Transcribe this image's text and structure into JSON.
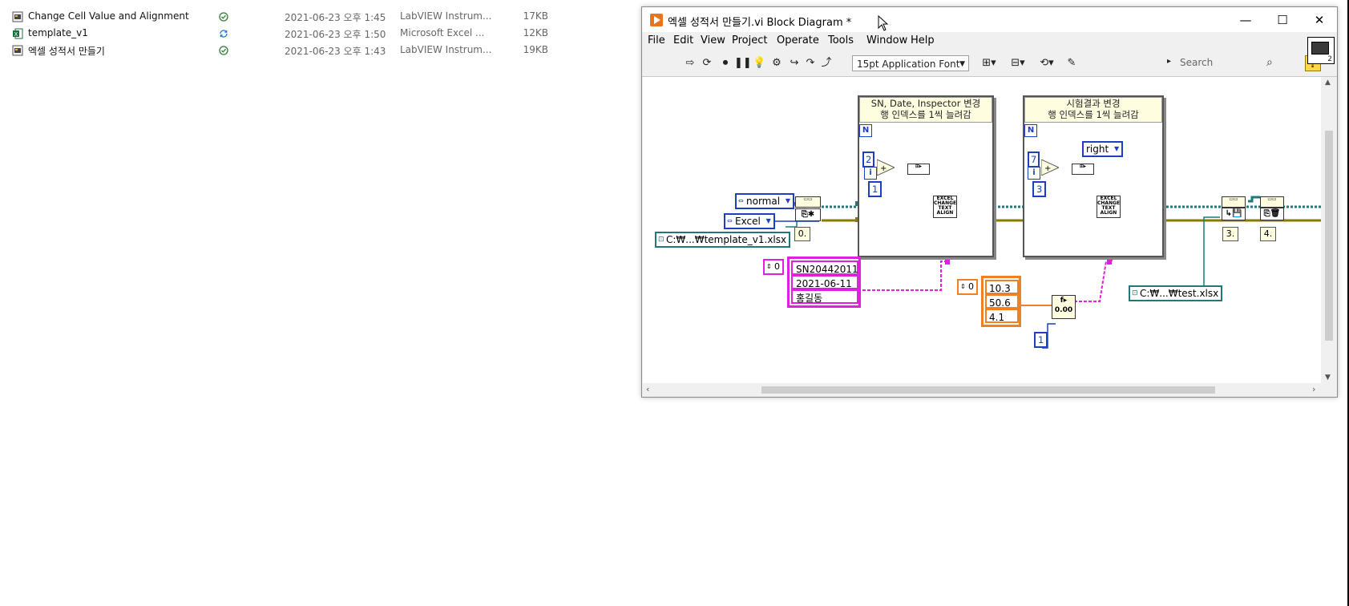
{
  "explorer": {
    "files": [
      {
        "name": "Change Cell Value and Alignment",
        "icon": "labview-vi-icon",
        "status": "synced-check-icon",
        "date": "2021-06-23 오후 1:45",
        "type": "LabVIEW Instrum...",
        "size": "17KB"
      },
      {
        "name": "template_v1",
        "icon": "excel-file-icon",
        "status": "sync-pending-icon",
        "date": "2021-06-23 오후 1:50",
        "type": "Microsoft Excel ...",
        "size": "12KB"
      },
      {
        "name": "엑셀 성적서 만들기",
        "icon": "labview-vi-icon",
        "status": "synced-check-icon",
        "date": "2021-06-23 오후 1:43",
        "type": "LabVIEW Instrum...",
        "size": "19KB"
      }
    ]
  },
  "window": {
    "title": "엑셀 성적서 만들기.vi Block Diagram *",
    "controls": {
      "minimize": "—",
      "maximize": "☐",
      "close": "✕"
    }
  },
  "menu": [
    "File",
    "Edit",
    "View",
    "Project",
    "Operate",
    "Tools",
    "Window",
    "Help"
  ],
  "toolbar": {
    "font": "15pt Application Font",
    "search_placeholder": "Search",
    "help": "?",
    "vi_icon_number": "2"
  },
  "diagram": {
    "loop1": {
      "label_line1": "SN, Date, Inspector 변경",
      "label_line2": "행 인덱스를 1씩 늘려감",
      "count_terminal": "N",
      "iteration_terminal": "i",
      "start_row": "2",
      "step": "1"
    },
    "loop2": {
      "label_line1": "시험결과 변경",
      "label_line2": "행 인덱스를 1씩 늘려감",
      "count_terminal": "N",
      "iteration_terminal": "i",
      "start_row": "7",
      "step": "3",
      "alignment": "right"
    },
    "open_mode": "normal",
    "app_type": "Excel",
    "template_path": "C:₩...₩template_v1.xlsx",
    "save_path": "C:₩...₩test.xlsx",
    "subvi_label": "EXCEL CHANGE TEXT ALIGN",
    "steps": [
      "0.",
      "3.",
      "4."
    ],
    "string_array": {
      "index": "0",
      "values": [
        "SN20442011",
        "2021-06-11",
        "홍길동"
      ]
    },
    "number_array": {
      "index": "0",
      "values": [
        "10.3",
        "50.6",
        "4.1"
      ]
    },
    "convert_constant": "1"
  },
  "colors": {
    "int_wire": "#1f3fbf",
    "string_wire": "#e020e0",
    "refnum_wire": "#1e7a7a",
    "error_wire": "#8a7a00",
    "number_wire": "#f08020",
    "loop_label_bg": "#fffde0"
  }
}
